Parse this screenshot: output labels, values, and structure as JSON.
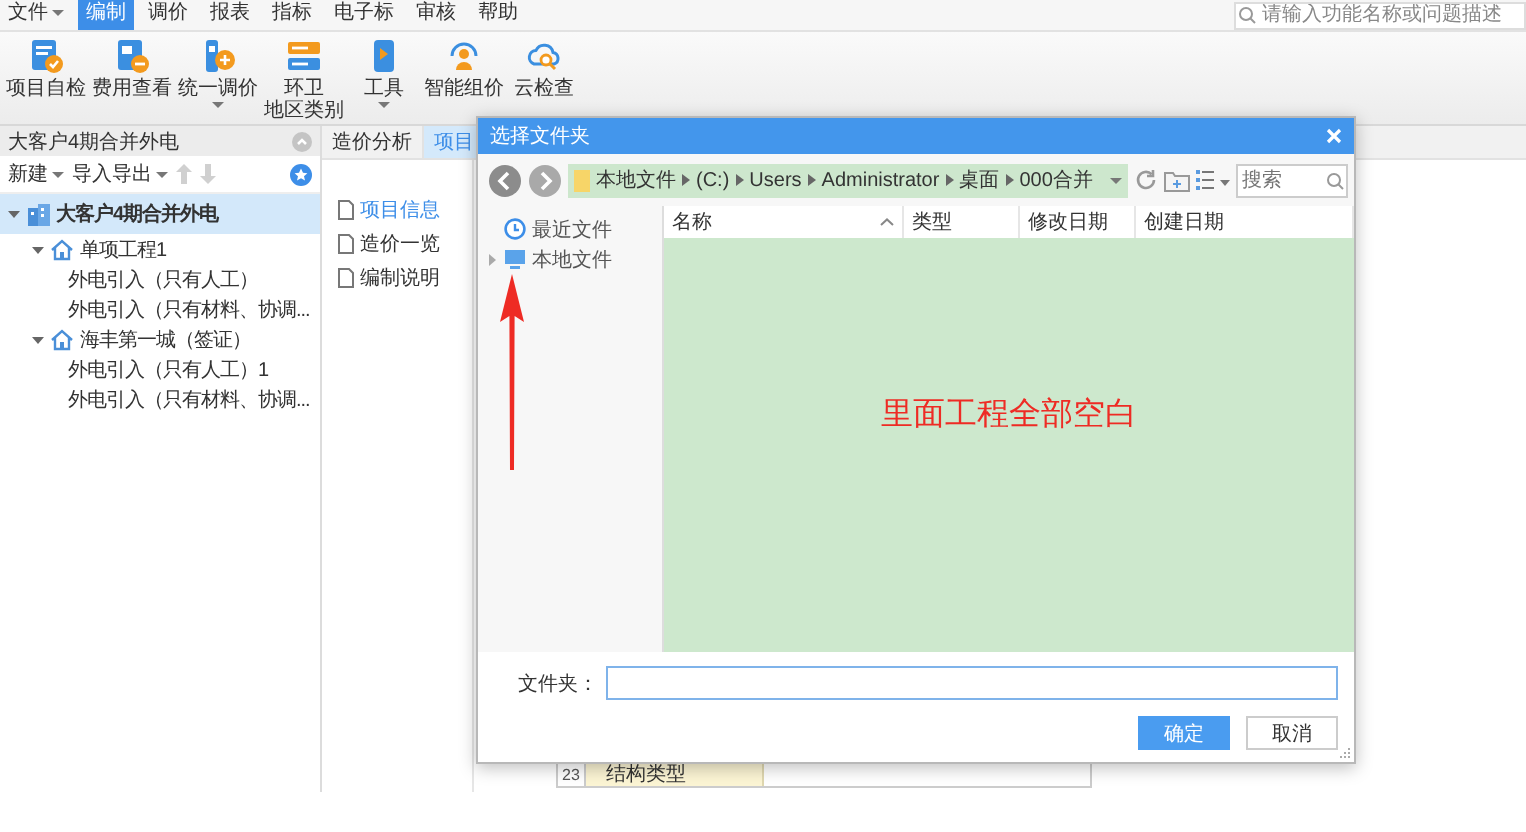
{
  "menu": [
    {
      "label": "文件",
      "dropdown": true,
      "selected": false
    },
    {
      "label": "编制",
      "dropdown": false,
      "selected": true
    },
    {
      "label": "调价",
      "dropdown": false,
      "selected": false
    },
    {
      "label": "报表",
      "dropdown": false,
      "selected": false
    },
    {
      "label": "指标",
      "dropdown": false,
      "selected": false
    },
    {
      "label": "电子标",
      "dropdown": false,
      "selected": false
    },
    {
      "label": "审核",
      "dropdown": false,
      "selected": false
    },
    {
      "label": "帮助",
      "dropdown": false,
      "selected": false
    }
  ],
  "search": {
    "placeholder": "请输入功能名称或问题描述"
  },
  "toolbar": [
    {
      "label": "项目自检",
      "dropdown": false
    },
    {
      "label": "费用查看",
      "dropdown": false
    },
    {
      "label": "统一调价",
      "dropdown": true
    },
    {
      "label": "环卫",
      "sublabel": "地区类别",
      "dropdown": false
    },
    {
      "label": "工具",
      "dropdown": true
    },
    {
      "label": "智能组价",
      "dropdown": false
    },
    {
      "label": "云检查",
      "dropdown": false
    }
  ],
  "project_panel": {
    "title": "大客户4期合并外电",
    "buttons": [
      {
        "label": "新建",
        "dropdown": true
      },
      {
        "label": "导入导出",
        "dropdown": true
      }
    ],
    "move_buttons": [
      {
        "disabled": true
      },
      {
        "disabled": true
      }
    ],
    "tree": [
      {
        "label": "大客户4期合并外电",
        "kind": "project",
        "expanded": true,
        "selected": true,
        "children": [
          {
            "label": "单项工程1",
            "kind": "item",
            "expanded": true,
            "selected": false,
            "children": [
              {
                "label": "外电引入（只有人工）",
                "kind": "unit",
                "selected": false
              },
              {
                "label": "外电引入（只有材料、协调...",
                "kind": "unit",
                "selected": false
              }
            ]
          },
          {
            "label": "海丰第一城（签证）",
            "kind": "item",
            "expanded": true,
            "selected": false,
            "children": [
              {
                "label": "外电引入（只有人工）1",
                "kind": "unit",
                "selected": false
              },
              {
                "label": "外电引入（只有材料、协调...",
                "kind": "unit",
                "selected": false
              }
            ]
          }
        ]
      }
    ]
  },
  "work_area": {
    "tabs": [
      {
        "label": "造价分析",
        "selected": false
      },
      {
        "label": "项目",
        "selected": true
      }
    ],
    "nav": [
      {
        "label": "项目信息",
        "selected": true
      },
      {
        "label": "造价一览",
        "selected": false
      },
      {
        "label": "编制说明",
        "selected": false
      }
    ],
    "table": {
      "rows": [
        {
          "number": "23",
          "name": "结构类型"
        }
      ]
    }
  },
  "dialog": {
    "title": "选择文件夹",
    "path": [
      "本地文件",
      "(C:)",
      "Users",
      "Administrator",
      "桌面",
      "000合并"
    ],
    "search": {
      "placeholder": "搜索"
    },
    "sidebar": [
      {
        "label": "最近文件",
        "kind": "recent"
      },
      {
        "label": "本地文件",
        "kind": "computer",
        "expanded": false
      }
    ],
    "columns": [
      {
        "label": "名称",
        "sorted": true
      },
      {
        "label": "类型",
        "sorted": false
      },
      {
        "label": "修改日期",
        "sorted": false
      },
      {
        "label": "创建日期",
        "sorted": false
      }
    ],
    "annotation": "里面工程全部空白",
    "folder_label": "文件夹：",
    "buttons": [
      {
        "label": "确定",
        "primary": true
      },
      {
        "label": "取消",
        "primary": false
      }
    ]
  }
}
